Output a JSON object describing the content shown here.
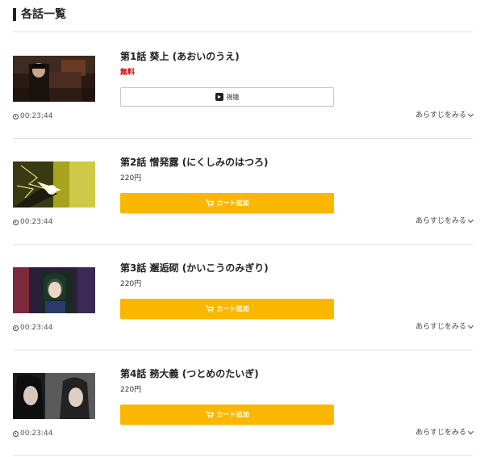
{
  "section": {
    "title": "各話一覧"
  },
  "episodes": [
    {
      "title": "第1話 葵上 (あおいのうえ)",
      "price": "無料",
      "button_label": "視聴",
      "button_type": "watch",
      "duration": "00:23:44",
      "synopsis_label": "あらすじをみる"
    },
    {
      "title": "第2話 憎発露 (にくしみのはつろ)",
      "price": "220円",
      "button_label": "カート追加",
      "button_type": "cart",
      "duration": "00:23:44",
      "synopsis_label": "あらすじをみる"
    },
    {
      "title": "第3話 邂逅砌 (かいこうのみぎり)",
      "price": "220円",
      "button_label": "カート追加",
      "button_type": "cart",
      "duration": "00:23:44",
      "synopsis_label": "あらすじをみる"
    },
    {
      "title": "第4話 務大義 (つとめのたいぎ)",
      "price": "220円",
      "button_label": "カート追加",
      "button_type": "cart",
      "duration": "00:23:44",
      "synopsis_label": "あらすじをみる"
    }
  ],
  "colors": {
    "cart_button": "#fbb700",
    "free_price": "#cc0000"
  },
  "icons": {
    "watch": "play-icon",
    "cart": "cart-icon",
    "duration": "clock-icon",
    "synopsis": "chevron-down-icon"
  }
}
